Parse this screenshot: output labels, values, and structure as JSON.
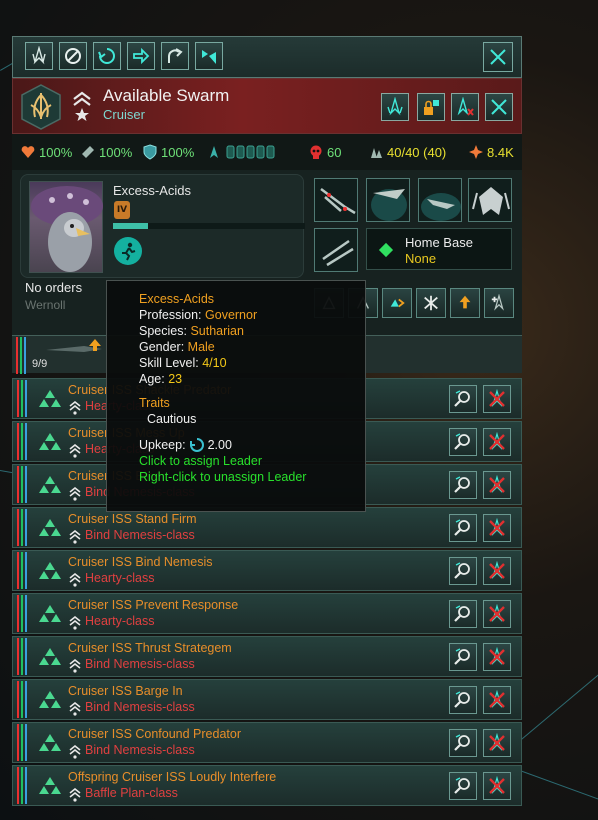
{
  "toolbar": {
    "buttons": [
      "fleet-stance-icon",
      "stop-icon",
      "patrol-icon",
      "move-icon",
      "retreat-icon",
      "merge-icon"
    ],
    "close_icon": "close-icon"
  },
  "header": {
    "fleet_name": "Available Swarm",
    "fleet_type": "Cruiser",
    "header_color": "#7a2020"
  },
  "stats": {
    "hull": "100%",
    "armor": "100%",
    "shields": "100%",
    "fleet_power": "60",
    "command_limit": "40/40 (40)",
    "upkeep": "8.4K"
  },
  "leader": {
    "name": "Excess-Acids",
    "level": "IV",
    "xp_fraction": 0.18,
    "orders": "No orders",
    "faded_name": "Wernoll"
  },
  "home_base": {
    "label": "Home Base",
    "value": "None"
  },
  "group": {
    "count": "9/9"
  },
  "tooltip": {
    "name": "Excess-Acids",
    "profession_label": "Profession:",
    "profession": "Governor",
    "species_label": "Species:",
    "species": "Sutharian",
    "gender_label": "Gender:",
    "gender": "Male",
    "skill_label": "Skill Level:",
    "skill": "4/10",
    "age_label": "Age:",
    "age": "23",
    "traits_label": "Traits",
    "trait": "Cautious",
    "upkeep_label": "Upkeep:",
    "upkeep": "2.00",
    "click_hint": "Click to assign Leader",
    "right_click_hint": "Right-click to unassign Leader"
  },
  "ships": [
    {
      "name": "Cruiser ISS Shackle Predator",
      "class": "Hearty-class"
    },
    {
      "name": "Cruiser ISS Mess Up",
      "class": "Hearty-class"
    },
    {
      "name": "Cruiser ISS Bind",
      "class": "Bind Nemesis-class"
    },
    {
      "name": "Cruiser ISS Stand Firm",
      "class": "Bind Nemesis-class"
    },
    {
      "name": "Cruiser ISS Bind Nemesis",
      "class": "Hearty-class"
    },
    {
      "name": "Cruiser ISS Prevent Response",
      "class": "Hearty-class"
    },
    {
      "name": "Cruiser ISS Thrust Strategem",
      "class": "Bind Nemesis-class"
    },
    {
      "name": "Cruiser ISS Barge In",
      "class": "Bind Nemesis-class"
    },
    {
      "name": "Cruiser ISS Confound Predator",
      "class": "Bind Nemesis-class"
    },
    {
      "name": "Offspring Cruiser ISS Loudly Interfere",
      "class": "Baffle Plan-class"
    }
  ],
  "colors": {
    "ship_name": "#e88e2a",
    "ship_class": "#e04040",
    "stat_green": "#6ee078",
    "tooltip_orange": "#f0a020"
  }
}
